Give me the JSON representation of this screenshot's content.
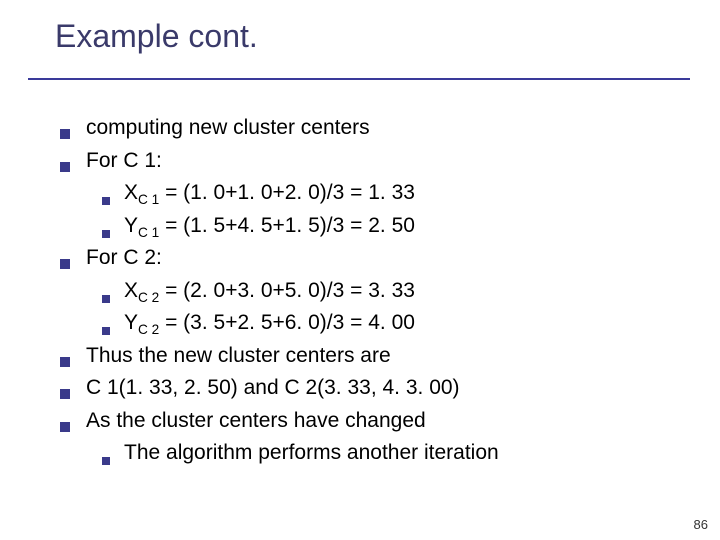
{
  "title": "Example cont.",
  "page_number": "86",
  "lines": {
    "l0": "computing new cluster centers",
    "l1": "For C 1:",
    "l2_pre": "X",
    "l2_sub": "C 1",
    "l2_post": " = (1. 0+1. 0+2. 0)/3 = 1. 33",
    "l3_pre": "Y",
    "l3_sub": "C 1",
    "l3_post": " = (1. 5+4. 5+1. 5)/3 = 2. 50",
    "l4": "For C 2:",
    "l5_pre": "X",
    "l5_sub": "C 2",
    "l5_post": " = (2. 0+3. 0+5. 0)/3 = 3. 33",
    "l6_pre": "Y",
    "l6_sub": "C 2",
    "l6_post": " = (3. 5+2. 5+6. 0)/3 = 4. 00",
    "l7": "Thus the new cluster centers are",
    "l8": "C 1(1. 33, 2. 50) and C 2(3. 33, 4. 3. 00)",
    "l9": "As the cluster centers have changed",
    "l10": "The algorithm performs another iteration"
  }
}
